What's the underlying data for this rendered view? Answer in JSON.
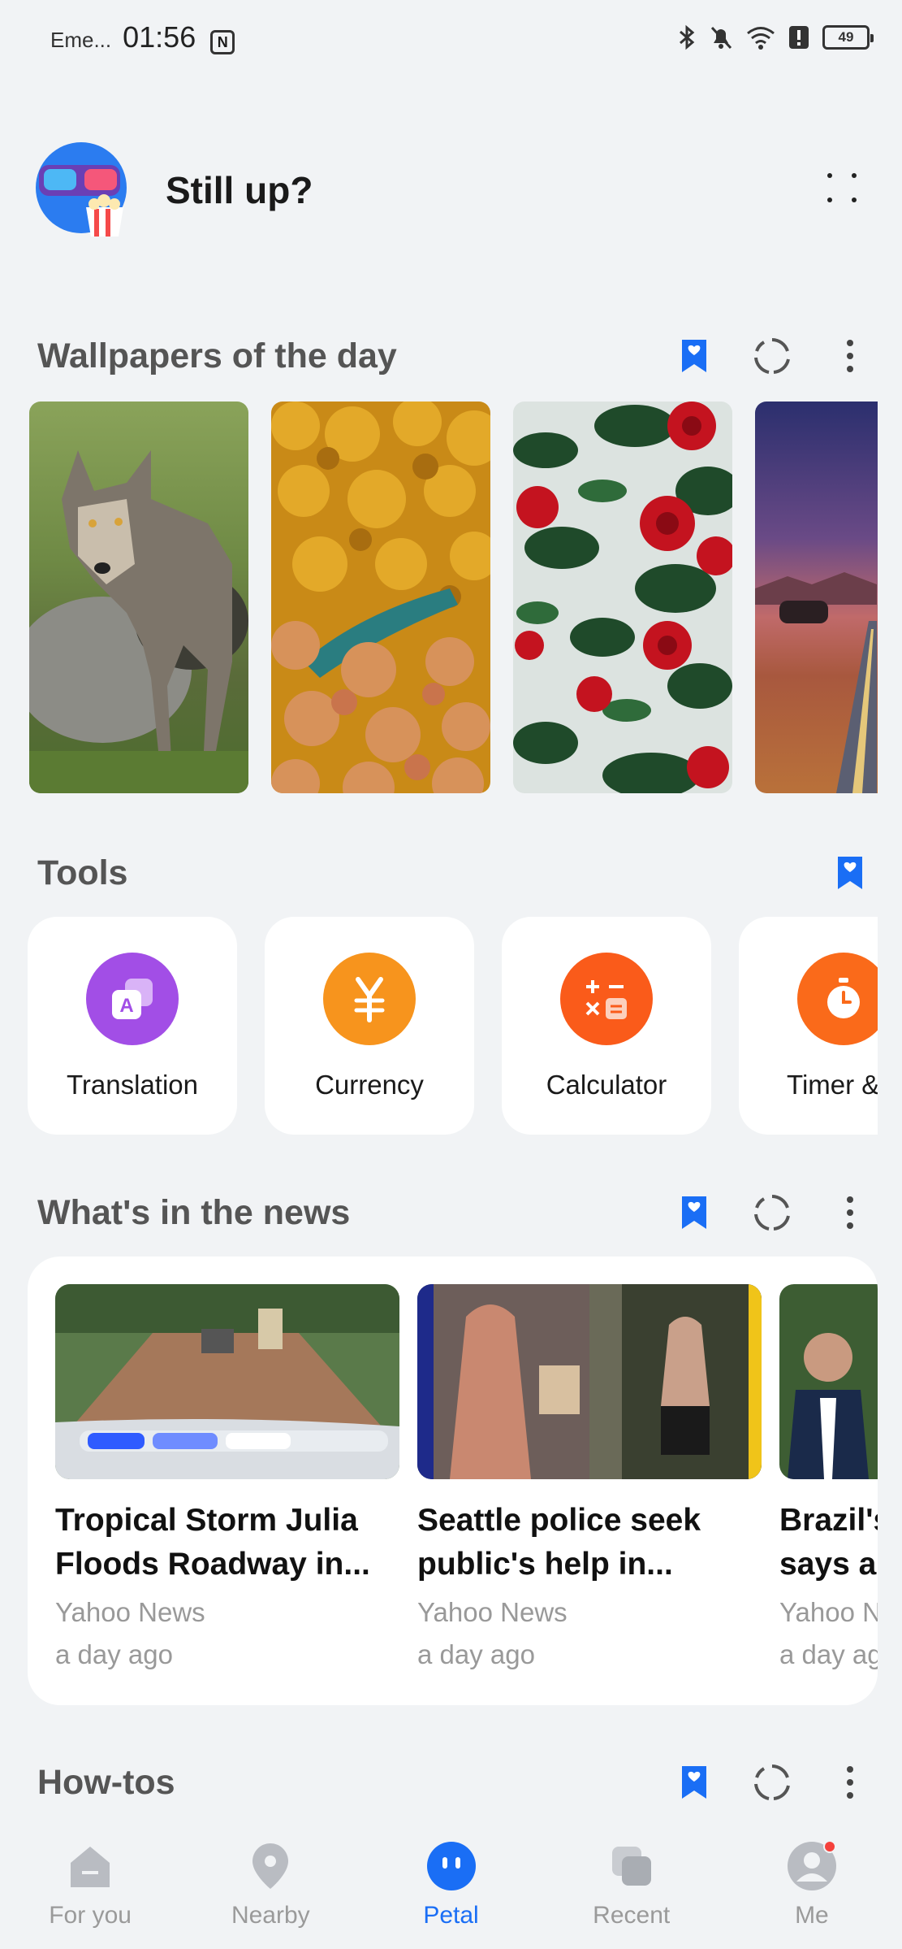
{
  "status_bar": {
    "carrier": "Eme...",
    "time": "01:56",
    "nfc_label": "N",
    "battery": "49"
  },
  "header": {
    "greeting": "Still up?"
  },
  "wallpapers": {
    "title": "Wallpapers of the day",
    "items": [
      "wolf",
      "autumn forest aerial",
      "red camellias",
      "desert road at dusk"
    ]
  },
  "tools": {
    "title": "Tools",
    "items": [
      {
        "label": "Translation",
        "icon": "translation-icon",
        "color": "#a24ee6"
      },
      {
        "label": "Currency",
        "icon": "currency-icon",
        "color": "#f7941d"
      },
      {
        "label": "Calculator",
        "icon": "calculator-icon",
        "color": "#fa5b1a"
      },
      {
        "label": "Timer & s",
        "icon": "timer-icon",
        "color": "#fa6a1a"
      }
    ]
  },
  "news": {
    "title": "What's in the news",
    "items": [
      {
        "title_line1": "Tropical Storm Julia",
        "title_line2": "Floods Roadway in...",
        "source": "Yahoo News",
        "time": "a day ago"
      },
      {
        "title_line1": "Seattle police seek",
        "title_line2": "public's help in...",
        "source": "Yahoo News",
        "time": "a day ago"
      },
      {
        "title_line1": "Brazil's",
        "title_line2": "says al",
        "source": "Yahoo N",
        "time": "a day ag"
      }
    ]
  },
  "howtos": {
    "title": "How-tos"
  },
  "nav": {
    "items": [
      {
        "label": "For you"
      },
      {
        "label": "Nearby"
      },
      {
        "label": "Petal"
      },
      {
        "label": "Recent"
      },
      {
        "label": "Me"
      }
    ],
    "active": "Petal",
    "accent": "#1a6ef5"
  }
}
